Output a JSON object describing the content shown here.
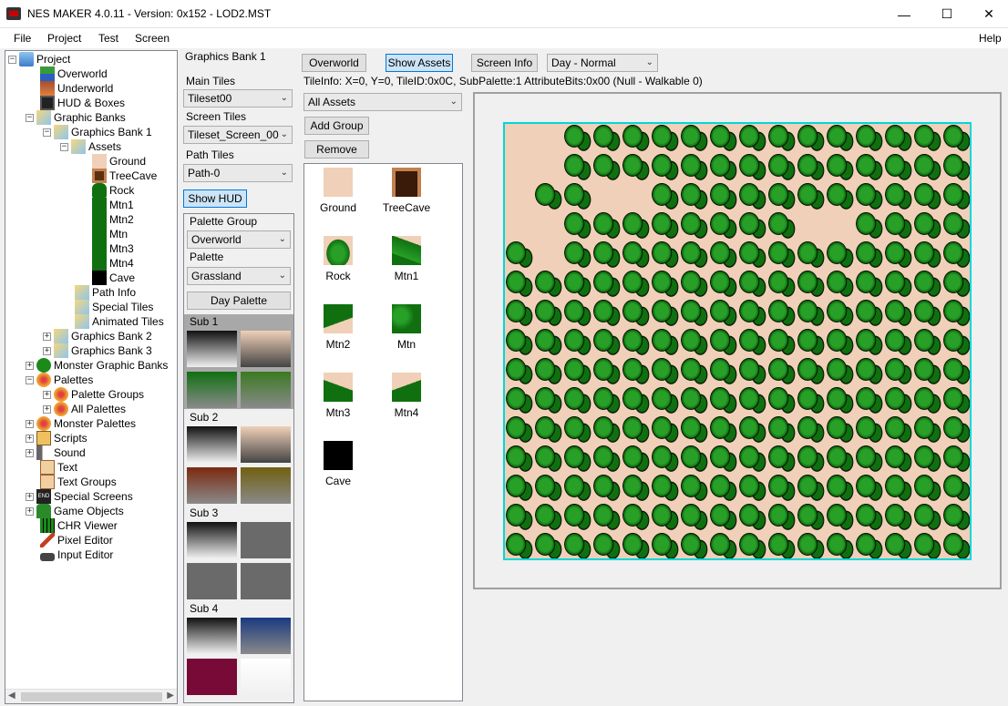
{
  "window": {
    "title": "NES MAKER 4.0.11 - Version: 0x152 - LOD2.MST",
    "minimize": "—",
    "maximize": "☐",
    "close": "✕"
  },
  "menu": {
    "file": "File",
    "project": "Project",
    "test": "Test",
    "screen": "Screen",
    "help": "Help"
  },
  "tree": {
    "project": "Project",
    "overworld": "Overworld",
    "underworld": "Underworld",
    "hud_boxes": "HUD & Boxes",
    "graphic_banks": "Graphic Banks",
    "graphics_bank_1": "Graphics Bank 1",
    "assets": "Assets",
    "ground": "Ground",
    "treecave": "TreeCave",
    "rock": "Rock",
    "mtn1": "Mtn1",
    "mtn2": "Mtn2",
    "mtn": "Mtn",
    "mtn3": "Mtn3",
    "mtn4": "Mtn4",
    "cave": "Cave",
    "path_info": "Path Info",
    "special_tiles": "Special Tiles",
    "animated_tiles": "Animated Tiles",
    "graphics_bank_2": "Graphics Bank 2",
    "graphics_bank_3": "Graphics Bank 3",
    "monster_graphic_banks": "Monster Graphic Banks",
    "palettes": "Palettes",
    "palette_groups": "Palette Groups",
    "all_palettes": "All Palettes",
    "monster_palettes": "Monster Palettes",
    "scripts": "Scripts",
    "sound": "Sound",
    "text": "Text",
    "text_groups": "Text Groups",
    "special_screens": "Special Screens",
    "game_objects": "Game Objects",
    "chr_viewer": "CHR Viewer",
    "pixel_editor": "Pixel Editor",
    "input_editor": "Input Editor",
    "end_icon_text": "END"
  },
  "bank": {
    "title": "Graphics Bank 1",
    "main_tiles_label": "Main Tiles",
    "main_tiles_value": "Tileset00",
    "screen_tiles_label": "Screen Tiles",
    "screen_tiles_value": "Tileset_Screen_00",
    "path_tiles_label": "Path Tiles",
    "path_tiles_value": "Path-0",
    "show_hud": "Show HUD",
    "palette_group_label": "Palette Group",
    "palette_group_value": "Overworld",
    "palette_label": "Palette",
    "palette_value": "Grassland",
    "day_palette": "Day Palette",
    "sub1": "Sub 1",
    "sub2": "Sub 2",
    "sub3": "Sub 3",
    "sub4": "Sub 4"
  },
  "toolbar": {
    "overworld": "Overworld",
    "show_assets": "Show Assets",
    "screen_info": "Screen Info",
    "time_value": "Day - Normal",
    "tile_info": "TileInfo: X=0, Y=0, TileID:0x0C, SubPalette:1 AttributeBits:0x00 (Null - Walkable 0)"
  },
  "assets": {
    "filter_value": "All Assets",
    "add_group": "Add Group",
    "remove": "Remove",
    "items": [
      "Ground",
      "TreeCave",
      "Rock",
      "Mtn1",
      "Mtn2",
      "Mtn",
      "Mtn3",
      "Mtn4",
      "Cave"
    ]
  },
  "colors": {
    "ground": "#f0d0b8",
    "bush": "#107010",
    "bush_light": "#28a028",
    "outline": "#000000"
  }
}
